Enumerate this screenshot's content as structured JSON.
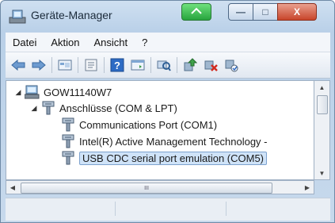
{
  "window": {
    "title": "Geräte-Manager"
  },
  "title_buttons": {
    "minimize_glyph": "—",
    "maximize_glyph": "□",
    "close_glyph": "X"
  },
  "menu": [
    "Datei",
    "Aktion",
    "Ansicht",
    "?"
  ],
  "toolbar": {
    "icons": [
      "back-arrow-icon",
      "forward-arrow-icon",
      "device-view-icon",
      "properties-icon",
      "help-icon",
      "console-icon",
      "scan-hardware-icon",
      "update-driver-icon",
      "uninstall-icon",
      "disable-icon"
    ]
  },
  "tree": {
    "computer": "GOW11140W7",
    "category": "Anschlüsse (COM & LPT)",
    "items": [
      "Communications Port (COM1)",
      "Intel(R) Active Management Technology -",
      "USB CDC serial port emulation (COM5)"
    ]
  },
  "scrollbar": {
    "grip": "III"
  },
  "colors": {
    "selection": "#cfe3f8",
    "close_button": "#c8452b",
    "accent_button": "#27a43e"
  }
}
